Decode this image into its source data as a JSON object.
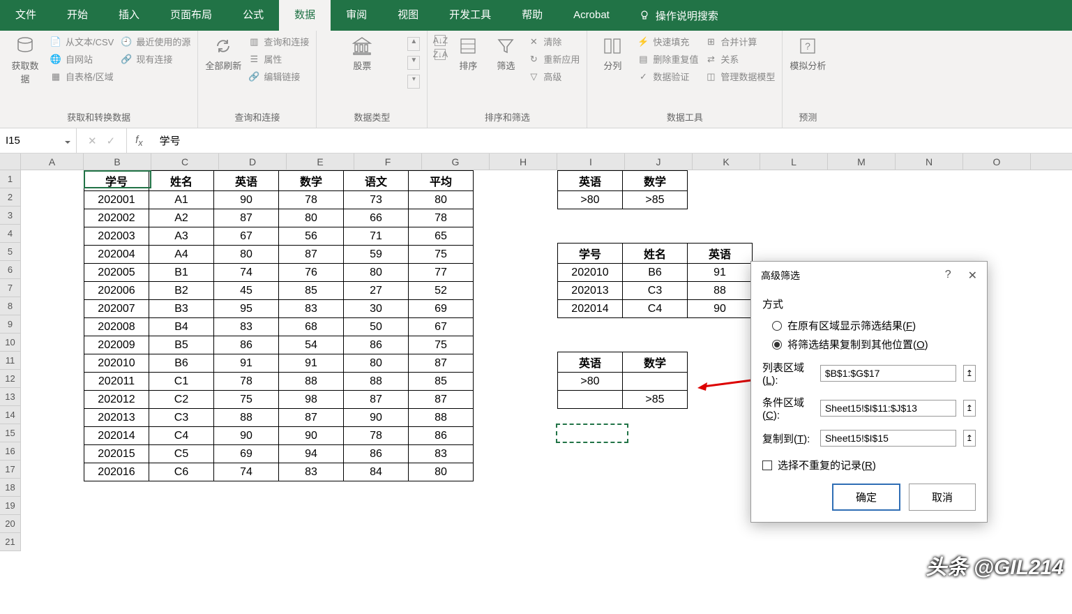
{
  "tabs": [
    "文件",
    "开始",
    "插入",
    "页面布局",
    "公式",
    "数据",
    "审阅",
    "视图",
    "开发工具",
    "帮助",
    "Acrobat"
  ],
  "active_tab_index": 5,
  "search_placeholder": "操作说明搜索",
  "ribbon": {
    "g1": {
      "label": "获取和转换数据",
      "big": "获取数\n据",
      "items": [
        "从文本/CSV",
        "自网站",
        "自表格/区域",
        "最近使用的源",
        "现有连接"
      ]
    },
    "g2": {
      "label": "查询和连接",
      "big": "全部刷新",
      "items": [
        "查询和连接",
        "属性",
        "编辑链接"
      ]
    },
    "g3": {
      "label": "数据类型",
      "big": "股票"
    },
    "g4": {
      "label": "排序和筛选",
      "b1": "排序",
      "b2": "筛选",
      "items": [
        "清除",
        "重新应用",
        "高级"
      ]
    },
    "g5": {
      "label": "数据工具",
      "big": "分列",
      "items": [
        "快速填充",
        "删除重复值",
        "数据验证",
        "合并计算",
        "关系",
        "管理数据模型"
      ]
    },
    "g6": {
      "label": "预测",
      "big": "模拟分析"
    }
  },
  "namebox": "I15",
  "formula": "学号",
  "columns": [
    "A",
    "B",
    "C",
    "D",
    "E",
    "F",
    "G",
    "H",
    "I",
    "J",
    "K",
    "L",
    "M",
    "N",
    "O"
  ],
  "rows": [
    "1",
    "2",
    "3",
    "4",
    "5",
    "6",
    "7",
    "8",
    "9",
    "10",
    "11",
    "12",
    "13",
    "14",
    "15",
    "16",
    "17",
    "18",
    "19",
    "20",
    "21"
  ],
  "main_table": {
    "headers": [
      "学号",
      "姓名",
      "英语",
      "数学",
      "语文",
      "平均"
    ],
    "rows": [
      [
        "202001",
        "A1",
        "90",
        "78",
        "73",
        "80"
      ],
      [
        "202002",
        "A2",
        "87",
        "80",
        "66",
        "78"
      ],
      [
        "202003",
        "A3",
        "67",
        "56",
        "71",
        "65"
      ],
      [
        "202004",
        "A4",
        "80",
        "87",
        "59",
        "75"
      ],
      [
        "202005",
        "B1",
        "74",
        "76",
        "80",
        "77"
      ],
      [
        "202006",
        "B2",
        "45",
        "85",
        "27",
        "52"
      ],
      [
        "202007",
        "B3",
        "95",
        "83",
        "30",
        "69"
      ],
      [
        "202008",
        "B4",
        "83",
        "68",
        "50",
        "67"
      ],
      [
        "202009",
        "B5",
        "86",
        "54",
        "86",
        "75"
      ],
      [
        "202010",
        "B6",
        "91",
        "91",
        "80",
        "87"
      ],
      [
        "202011",
        "C1",
        "78",
        "88",
        "88",
        "85"
      ],
      [
        "202012",
        "C2",
        "75",
        "98",
        "87",
        "87"
      ],
      [
        "202013",
        "C3",
        "88",
        "87",
        "90",
        "88"
      ],
      [
        "202014",
        "C4",
        "90",
        "90",
        "78",
        "86"
      ],
      [
        "202015",
        "C5",
        "69",
        "94",
        "86",
        "83"
      ],
      [
        "202016",
        "C6",
        "74",
        "83",
        "84",
        "80"
      ]
    ]
  },
  "criteria1": {
    "headers": [
      "英语",
      "数学"
    ],
    "row": [
      ">80",
      ">85"
    ]
  },
  "result_table": {
    "headers": [
      "学号",
      "姓名",
      "英语"
    ],
    "rows": [
      [
        "202010",
        "B6",
        "91"
      ],
      [
        "202013",
        "C3",
        "88"
      ],
      [
        "202014",
        "C4",
        "90"
      ]
    ]
  },
  "criteria2": {
    "headers": [
      "英语",
      "数学"
    ],
    "rows": [
      [
        ">80",
        ""
      ],
      [
        "",
        ">85"
      ]
    ]
  },
  "dialog": {
    "title": "高级筛选",
    "mode_label": "方式",
    "opt1": "在原有区域显示筛选结果(F)",
    "opt2": "将筛选结果复制到其他位置(O)",
    "field1_label": "列表区域(L):",
    "field1_value": "$B$1:$G$17",
    "field2_label": "条件区域(C):",
    "field2_value": "Sheet15!$I$11:$J$13",
    "field3_label": "复制到(T):",
    "field3_value": "Sheet15!$I$15",
    "unique": "选择不重复的记录(R)",
    "ok": "确定",
    "cancel": "取消"
  },
  "watermark": "头条 @GIL214"
}
